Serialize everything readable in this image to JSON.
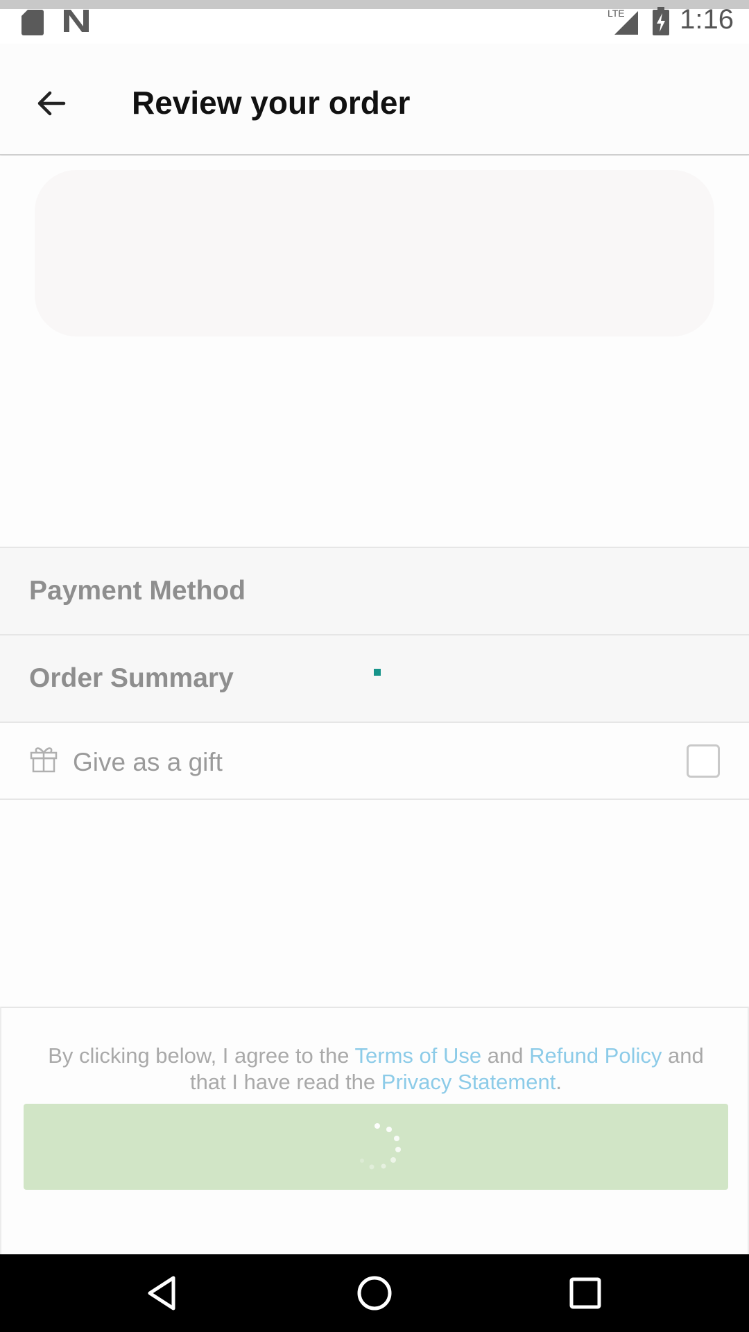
{
  "status_bar": {
    "time": "1:16",
    "network": "LTE",
    "icons": [
      "sd-card-icon",
      "n-logo-icon",
      "lte-signal-icon",
      "battery-charging-icon"
    ]
  },
  "app_bar": {
    "title": "Review your order",
    "back_icon": "arrow-back-icon"
  },
  "sections": {
    "payment_method": "Payment Method",
    "order_summary": "Order Summary"
  },
  "gift": {
    "label": "Give as a gift",
    "icon": "gift-icon",
    "checked": false
  },
  "terms": {
    "prefix": "By clicking below, I agree to the ",
    "terms_link": "Terms of Use",
    "and1": " and ",
    "refund_link": "Refund Policy",
    "and2": " and that I have read the ",
    "privacy_link": "Privacy Statement",
    "suffix": "."
  },
  "place_order": {
    "state": "loading"
  },
  "nav_bar": {
    "icons": [
      "back-triangle-icon",
      "home-circle-icon",
      "recents-square-icon"
    ]
  },
  "colors": {
    "link": "#8ccbe8",
    "button_loading": "#d1e5c6",
    "progress": "#17948a"
  }
}
